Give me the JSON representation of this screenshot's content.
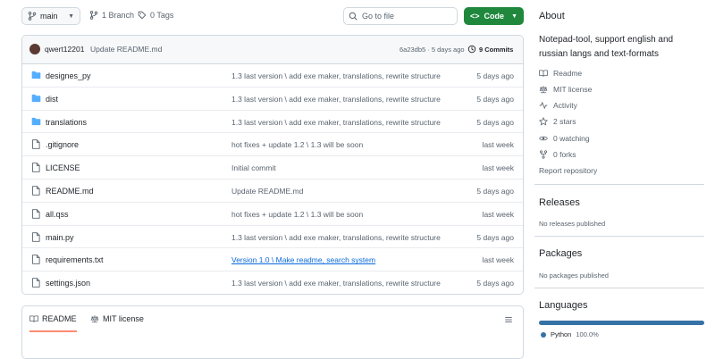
{
  "toolbar": {
    "branch": "main",
    "branches": "1 Branch",
    "tags": "0 Tags",
    "search_placeholder": "Go to file",
    "code_label": "Code"
  },
  "commit": {
    "author": "qwert12201",
    "message": "Update README.md",
    "hash_time": "6a23db5 · 5 days ago",
    "commits_count": "9 Commits"
  },
  "files": [
    {
      "type": "folder",
      "name": "designes_py",
      "message": "1.3 last version \\ add exe maker, translations, rewrite structure",
      "date": "5 days ago",
      "link": false
    },
    {
      "type": "folder",
      "name": "dist",
      "message": "1.3 last version \\ add exe maker, translations, rewrite structure",
      "date": "5 days ago",
      "link": false
    },
    {
      "type": "folder",
      "name": "translations",
      "message": "1.3 last version \\ add exe maker, translations, rewrite structure",
      "date": "5 days ago",
      "link": false
    },
    {
      "type": "file",
      "name": ".gitignore",
      "message": "hot fixes + update 1.2 \\ 1.3 will be soon",
      "date": "last week",
      "link": false
    },
    {
      "type": "file",
      "name": "LICENSE",
      "message": "Initial commit",
      "date": "last week",
      "link": false
    },
    {
      "type": "file",
      "name": "README.md",
      "message": "Update README.md",
      "date": "5 days ago",
      "link": false
    },
    {
      "type": "file",
      "name": "all.qss",
      "message": "hot fixes + update 1.2 \\ 1.3 will be soon",
      "date": "last week",
      "link": false
    },
    {
      "type": "file",
      "name": "main.py",
      "message": "1.3 last version \\ add exe maker, translations, rewrite structure",
      "date": "5 days ago",
      "link": false
    },
    {
      "type": "file",
      "name": "requirements.txt",
      "message": "Version 1.0 \\ Make readme, search system",
      "date": "last week",
      "link": true
    },
    {
      "type": "file",
      "name": "settings.json",
      "message": "1.3 last version \\ add exe maker, translations, rewrite structure",
      "date": "5 days ago",
      "link": false
    }
  ],
  "readme_tabs": {
    "readme": "README",
    "license": "MIT license"
  },
  "sidebar": {
    "about_title": "About",
    "description": "Notepad-tool, support english and russian langs and text-formats",
    "readme": "Readme",
    "license": "MIT license",
    "activity": "Activity",
    "stars": "2 stars",
    "watching": "0 watching",
    "forks": "0 forks",
    "report": "Report repository",
    "releases_title": "Releases",
    "releases_text": "No releases published",
    "packages_title": "Packages",
    "packages_text": "No packages published",
    "languages_title": "Languages",
    "language": "Python",
    "language_percent": "100.0%",
    "language_fraction": 1.0,
    "language_color": "#3572A5"
  },
  "colors": {
    "accent": "#1f883d",
    "folder": "#54aeff",
    "link": "#0969da"
  }
}
